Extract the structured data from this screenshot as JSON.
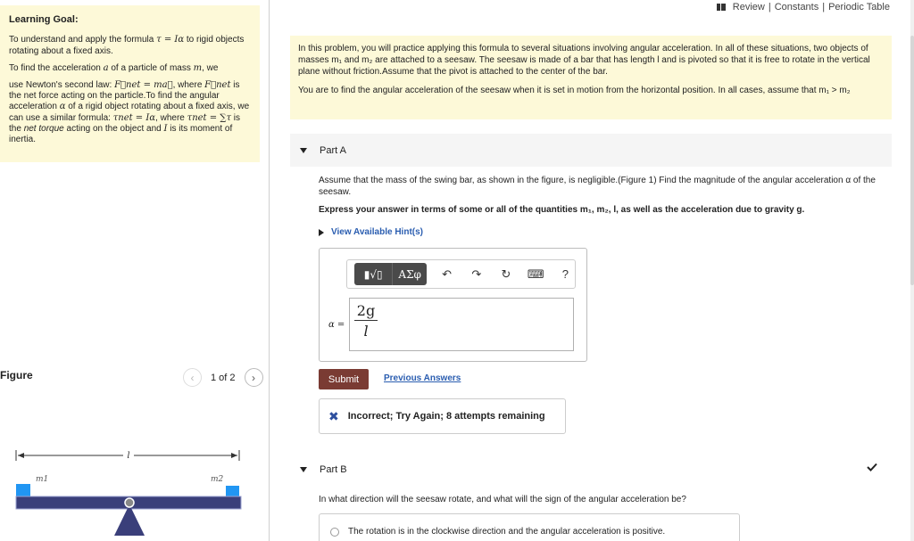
{
  "top_links": {
    "review": "Review",
    "sep1": "|",
    "constants": "Constants",
    "sep2": "|",
    "periodic": "Periodic Table"
  },
  "goal": {
    "title": "Learning Goal:",
    "p1_a": "To understand and apply the formula ",
    "p1_formula": "τ = Iα",
    "p1_b": " to rigid objects rotating about a fixed axis.",
    "p2_a": "To find the acceleration ",
    "p2_var_a": "a",
    "p2_b": " of a particle of mass ",
    "p2_var_m": "m",
    "p2_c": ", we",
    "p3_a": "use Newton's second law: ",
    "p3_formula": "F⃗net = ma⃗",
    "p3_b": ", where ",
    "p3_fnet": "F⃗net",
    "p3_c": " is the net force acting on the particle.To find the angular acceleration ",
    "p3_alpha": "α",
    "p3_d": " of a rigid object rotating about a fixed axis, we can use a similar formula: ",
    "p3_formula2": "τnet = Iα",
    "p3_e": ", where ",
    "p3_tau": "τnet = ∑τ",
    "p3_f": " is the ",
    "p3_nt": "net torque",
    "p3_g": " acting on the object and ",
    "p3_I": "I",
    "p3_h": " is its moment of inertia."
  },
  "figure": {
    "label": "Figure",
    "page": "1 of 2",
    "prev": "‹",
    "next": "›",
    "length_label": "l",
    "m1_label": "m1",
    "m2_label": "m2"
  },
  "intro": {
    "p1": "In this problem, you will practice applying this formula to several situations involving angular acceleration. In all of these situations, two objects of masses m₁ and m₂ are attached to a seesaw. The seesaw is made of a bar that has length l and is pivoted so that it is free to rotate in the vertical plane without friction.Assume that the pivot is attached to the center of the bar.",
    "p2": "You are to find the angular acceleration of the seesaw when it is set in motion from the horizontal position. In all cases, assume that m₁ > m₂"
  },
  "part_a": {
    "header": "Part A",
    "text": "Assume that the mass of the swing bar, as shown in the figure, is negligible.(Figure 1) Find the magnitude of the angular acceleration α of the seesaw.",
    "express": "Express your answer in terms of some or all of the quantities m₁, m₂, l, as well as the acceleration due to gravity g.",
    "hints": "View Available Hint(s)",
    "toolbar": {
      "templates": "▮√▯",
      "symbols": "ΑΣφ",
      "undo": "↶",
      "redo": "↷",
      "reset": "↻",
      "keyboard": "⌨",
      "help": "?"
    },
    "alpha_label": "α =",
    "answer_num": "2g",
    "answer_den": "l",
    "submit": "Submit",
    "previous": "Previous Answers",
    "feedback_icon": "✖",
    "feedback": "Incorrect; Try Again; 8 attempts remaining"
  },
  "part_b": {
    "header": "Part B",
    "question": "In what direction will the seesaw rotate, and what will the sign of the angular acceleration be?",
    "option1": "The rotation is in the clockwise direction and the angular acceleration is positive."
  },
  "colors": {
    "note_bg": "#fdf9d8",
    "submit_bg": "#7a3b33",
    "link": "#2a5db0",
    "seesaw_block": "#2196f3",
    "seesaw_bar": "#3a3f7a"
  }
}
